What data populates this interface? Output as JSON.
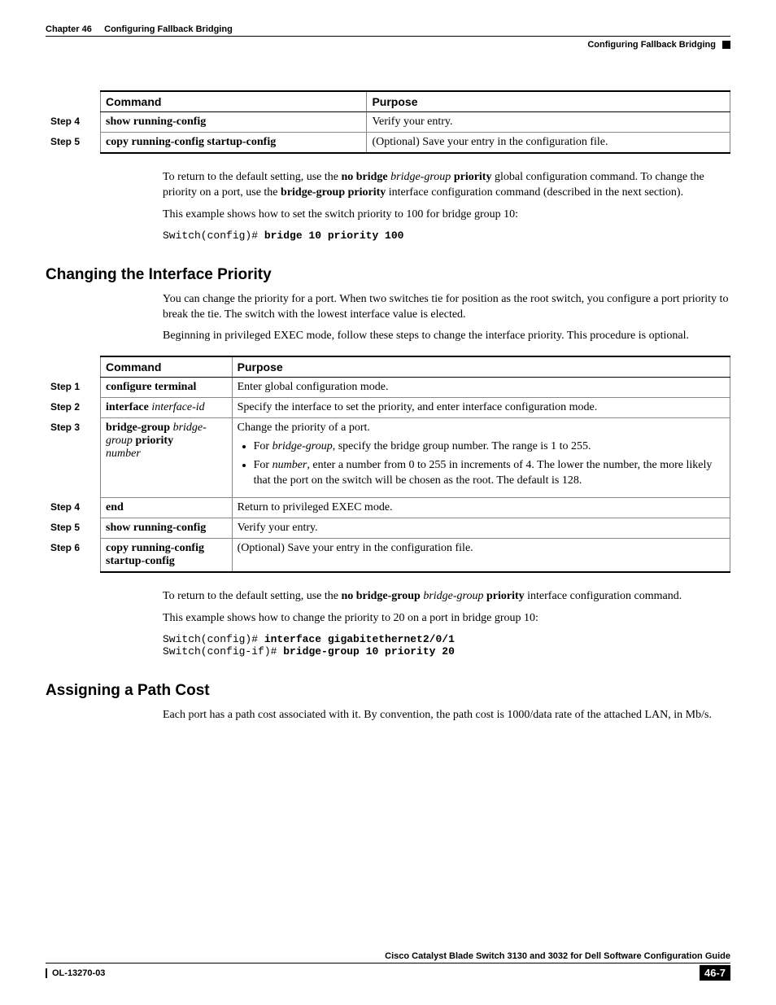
{
  "header": {
    "chapter": "Chapter 46",
    "chapter_title": "Configuring Fallback Bridging",
    "section": "Configuring Fallback Bridging"
  },
  "table1": {
    "head_command": "Command",
    "head_purpose": "Purpose",
    "rows": [
      {
        "step": "Step 4",
        "cmd": "show running-config",
        "purpose": "Verify your entry."
      },
      {
        "step": "Step 5",
        "cmd": "copy running-config startup-config",
        "purpose": "(Optional) Save your entry in the configuration file."
      }
    ]
  },
  "body1": {
    "p1a": "To return to the default setting, use the ",
    "p1b": "no bridge",
    "p1c": " bridge-group ",
    "p1d": "priority",
    "p1e": " global configuration command. To change the priority on a port, use the ",
    "p1f": "bridge-group priority",
    "p1g": " interface configuration command (described in the next section).",
    "p2": "This example shows how to set the switch priority to 100 for bridge group 10:",
    "code_prefix": "Switch(config)# ",
    "code_cmd": "bridge 10 priority 100"
  },
  "section2": {
    "title": "Changing the Interface Priority",
    "p1": "You can change the priority for a port. When two switches tie for position as the root switch, you configure a port priority to break the tie. The switch with the lowest interface value is elected.",
    "p2": "Beginning in privileged EXEC mode, follow these steps to change the interface priority. This procedure is optional."
  },
  "table2": {
    "head_command": "Command",
    "head_purpose": "Purpose",
    "rows": {
      "r1": {
        "step": "Step 1",
        "cmd": "configure terminal",
        "purpose": "Enter global configuration mode."
      },
      "r2": {
        "step": "Step 2",
        "cmd_b1": "interface",
        "cmd_i1": " interface-id",
        "purpose": "Specify the interface to set the priority, and enter interface configuration mode."
      },
      "r3": {
        "step": "Step 3",
        "cmd_b1": "bridge-group",
        "cmd_i1": " bridge-group ",
        "cmd_b2": "priority",
        "cmd_i2": "number",
        "p_intro": "Change the priority of a port.",
        "li1a": "For ",
        "li1b": "bridge-group",
        "li1c": ", specify the bridge group number. The range is 1 to 255.",
        "li2a": "For ",
        "li2b": "number",
        "li2c": ", enter a number from 0 to 255 in increments of 4. The lower the number, the more likely that the port on the switch will be chosen as the root. The default is 128."
      },
      "r4": {
        "step": "Step 4",
        "cmd": "end",
        "purpose": "Return to privileged EXEC mode."
      },
      "r5": {
        "step": "Step 5",
        "cmd": "show running-config",
        "purpose": "Verify your entry."
      },
      "r6": {
        "step": "Step 6",
        "cmd": "copy running-config startup-config",
        "purpose": "(Optional) Save your entry in the configuration file."
      }
    }
  },
  "body2": {
    "p1a": "To return to the default setting, use the ",
    "p1b": "no bridge-group",
    "p1c": " bridge-group ",
    "p1d": "priority",
    "p1e": " interface configuration command.",
    "p2": "This example shows how to change the priority to 20 on a port in bridge group 10:",
    "code1_prefix": "Switch(config)# ",
    "code1_cmd": "interface gigabitethernet2/0/1",
    "code2_prefix": "Switch(config-if)# ",
    "code2_cmd": "bridge-group 10 priority 20"
  },
  "section3": {
    "title": "Assigning a Path Cost",
    "p1": "Each port has a path cost associated with it. By convention, the path cost is 1000/data rate of the attached LAN, in Mb/s."
  },
  "footer": {
    "guide": "Cisco Catalyst Blade Switch 3130 and 3032 for Dell Software Configuration Guide",
    "doc_id": "OL-13270-03",
    "page": "46-7"
  }
}
